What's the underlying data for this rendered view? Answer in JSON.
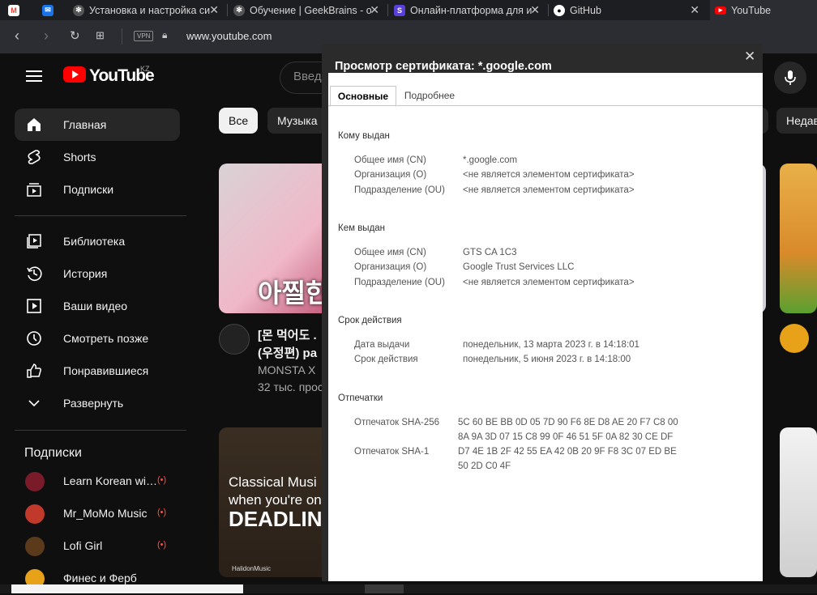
{
  "browser": {
    "tabs": [
      {
        "label": "",
        "icon": "gmail-icon"
      },
      {
        "label": "",
        "icon": "mail-icon"
      },
      {
        "label": "Установка и настройка си",
        "icon": "openai-icon"
      },
      {
        "label": "Обучение | GeekBrains - о",
        "icon": "openai-icon"
      },
      {
        "label": "Онлайн-платформа для из",
        "icon": "s-icon"
      },
      {
        "label": "GitHub",
        "icon": "github-icon"
      },
      {
        "label": "YouTube",
        "icon": "youtube-icon"
      }
    ],
    "vpn": "VPN",
    "url": "www.youtube.com"
  },
  "youtube": {
    "logo_text": "YouTube",
    "region": "KZ",
    "search_placeholder": "Введ",
    "chips": [
      "Все",
      "Музыка",
      "Недав"
    ],
    "sidebar": [
      {
        "label": "Главная",
        "icon": "home-icon"
      },
      {
        "label": "Shorts",
        "icon": "shorts-icon"
      },
      {
        "label": "Подписки",
        "icon": "subscriptions-icon"
      },
      {
        "label": "Библиотека",
        "icon": "library-icon"
      },
      {
        "label": "История",
        "icon": "history-icon"
      },
      {
        "label": "Ваши видео",
        "icon": "your-videos-icon"
      },
      {
        "label": "Смотреть позже",
        "icon": "watch-later-icon"
      },
      {
        "label": "Понравившиеся",
        "icon": "like-icon"
      },
      {
        "label": "Развернуть",
        "icon": "chevron-down-icon"
      }
    ],
    "subscriptions_title": "Подписки",
    "subscriptions": [
      {
        "label": "Learn Korean wit...",
        "live": "(•)"
      },
      {
        "label": "Mr_MoMo Music",
        "live": "(•)"
      },
      {
        "label": "Lofi Girl",
        "live": "(•)"
      },
      {
        "label": "Финес и Ферб",
        "live": ""
      }
    ],
    "video1": {
      "title_line1": "[몬 먹어도 .",
      "title_line2": "(우정편) pa",
      "channel": "MONSTA X",
      "views": "32 тыс. прос",
      "thumb_text": "아찔한"
    },
    "video2": {
      "thumb_line1": "Classical Musi",
      "thumb_line2": "when you're on",
      "thumb_line3": "DEADLIN",
      "thumb_credit": "HalidonMusic"
    }
  },
  "certificate": {
    "title": "Просмотр сертификата: *.google.com",
    "tabs": [
      "Основные",
      "Подробнее"
    ],
    "issued_to": {
      "heading": "Кому выдан",
      "fields": [
        {
          "k": "Общее имя (CN)",
          "v": "*.google.com"
        },
        {
          "k": "Организация (O)",
          "v": "<не является элементом сертификата>"
        },
        {
          "k": "Подразделение (OU)",
          "v": "<не является элементом сертификата>"
        }
      ]
    },
    "issued_by": {
      "heading": "Кем выдан",
      "fields": [
        {
          "k": "Общее имя (CN)",
          "v": "GTS CA 1C3"
        },
        {
          "k": "Организация (O)",
          "v": "Google Trust Services LLC"
        },
        {
          "k": "Подразделение (OU)",
          "v": "<не является элементом сертификата>"
        }
      ]
    },
    "validity": {
      "heading": "Срок действия",
      "fields": [
        {
          "k": "Дата выдачи",
          "v": "понедельник, 13 марта 2023 г. в 14:18:01"
        },
        {
          "k": "Срок действия",
          "v": "понедельник, 5 июня 2023 г. в 14:18:00"
        }
      ]
    },
    "fingerprints": {
      "heading": "Отпечатки",
      "sha256_label": "Отпечаток SHA-256",
      "sha256_line1": "5C 60 BE BB 0D 05 7D 90 F6 8E D8 AE 20 F7 C8 00",
      "sha256_line2": "8A 9A 3D 07 15 C8 99 0F 46 51 5F 0A 82 30 CE DF",
      "sha1_label": "Отпечаток SHA-1",
      "sha1_line1": "D7 4E 1B 2F 42 55 EA 42 0B 20 9F F8 3C 07 ED BE",
      "sha1_line2": "50 2D C0 4F"
    }
  },
  "colors": {
    "accent": "#ff0000",
    "dialog_bg": "#2b2b2b"
  }
}
